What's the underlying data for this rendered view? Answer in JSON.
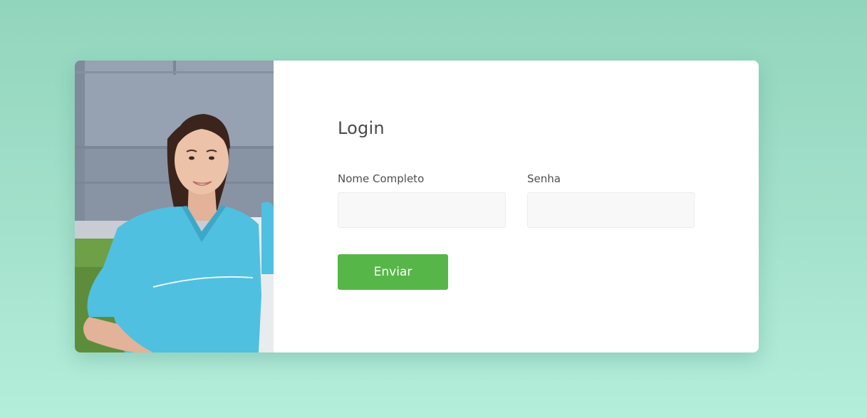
{
  "login": {
    "title": "Login",
    "fields": {
      "name": {
        "label": "Nome Completo",
        "value": "",
        "placeholder": ""
      },
      "password": {
        "label": "Senha",
        "value": "",
        "placeholder": ""
      }
    },
    "submit_label": "Enviar"
  },
  "colors": {
    "background_gradient": [
      "#92d5bd",
      "#b3eedb"
    ],
    "button": "#56b748",
    "scrubs": "#4fc0e0"
  },
  "image": {
    "subject": "smiling nurse in light-blue scrubs"
  }
}
